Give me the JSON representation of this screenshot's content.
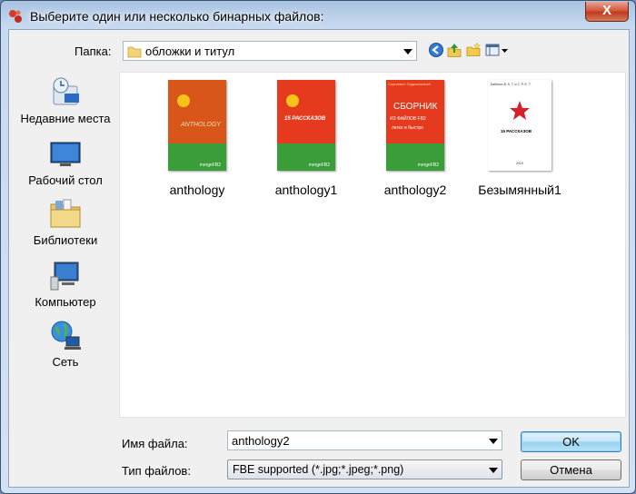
{
  "window": {
    "title": "Выберите один или несколько бинарных файлов:",
    "close_glyph": "X"
  },
  "location": {
    "label": "Папка:",
    "current_folder": "обложки и титул"
  },
  "toolbar": {
    "icons": [
      "back-icon",
      "up-folder-icon",
      "new-folder-icon",
      "view-menu-icon"
    ]
  },
  "places": [
    {
      "label": "Недавние места",
      "icon": "recent-places-icon"
    },
    {
      "label": "Рабочий стол",
      "icon": "desktop-icon"
    },
    {
      "label": "Библиотеки",
      "icon": "libraries-icon"
    },
    {
      "label": "Компьютер",
      "icon": "computer-icon"
    },
    {
      "label": "Сеть",
      "icon": "network-icon"
    }
  ],
  "files": [
    {
      "name": "anthology",
      "cover_text": "ANTHOLOGY",
      "cover_footer": "mergeFB2"
    },
    {
      "name": "anthology1",
      "cover_text": "15 РАССКАЗОВ",
      "cover_footer": "mergeFB2"
    },
    {
      "name": "anthology2",
      "cover_header": "Сергеевич Подкопаемый",
      "cover_text": "СБОРНИК",
      "cover_sub1": "ИЗ ФАЙЛОВ FB2",
      "cover_sub2": "легко и быстро",
      "cover_footer": "mergeFB2"
    },
    {
      "name": "Безымянный1",
      "cover_header": "Бабенко В. К. Т. и С. Р. Е. Т.",
      "cover_text": "15 РАССКАЗОВ",
      "cover_footer": "2015"
    }
  ],
  "filename": {
    "label": "Имя файла:",
    "value": "anthology2"
  },
  "filetype": {
    "label": "Тип файлов:",
    "value": "FBE supported (*.jpg;*.jpeg;*.png)"
  },
  "buttons": {
    "ok": "OK",
    "cancel": "Отмена"
  },
  "colors": {
    "cover_orange": "#d8561a",
    "cover_red": "#e53a1e",
    "cover_green": "#3a9d3a",
    "ok_blue": "#3c7fb1"
  }
}
